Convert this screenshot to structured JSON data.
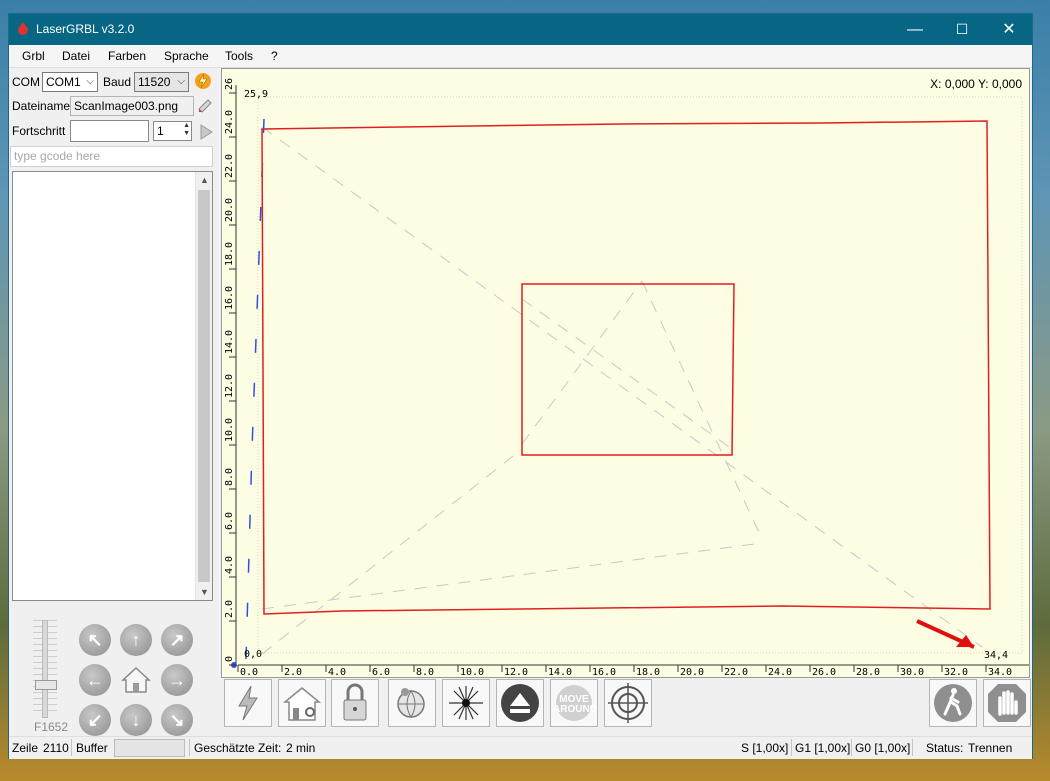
{
  "window": {
    "title": "LaserGRBL v3.2.0",
    "minimize": "—",
    "maximize": "☐",
    "close": "✕"
  },
  "menu": [
    "Grbl",
    "Datei",
    "Farben",
    "Sprache",
    "Tools",
    "?"
  ],
  "connection": {
    "com_label": "COM",
    "com_value": "COM1",
    "baud_label": "Baud",
    "baud_value": "11520"
  },
  "file": {
    "label": "Dateiname",
    "value": "ScanImage003.png"
  },
  "progress": {
    "label": "Fortschritt",
    "passes": "1"
  },
  "gcode": {
    "placeholder": "type gcode here"
  },
  "jog": {
    "speed_label": "F1652"
  },
  "canvas": {
    "coords": "X: 0,000 Y: 0,000",
    "corner_top_left": "25,9",
    "corner_origin": "0,0",
    "corner_bottom_right": "34,4",
    "x_ticks": [
      "0.0",
      "2.0",
      "4.0",
      "6.0",
      "8.0",
      "10.0",
      "12.0",
      "14.0",
      "16.0",
      "18.0",
      "20.0",
      "22.0",
      "24.0",
      "26.0",
      "28.0",
      "30.0",
      "32.0",
      "34.0"
    ],
    "y_ticks": [
      "0",
      "2.0",
      "4.0",
      "6.0",
      "8.0",
      "10.0",
      "12.0",
      "14.0",
      "16.0",
      "18.0",
      "20.0",
      "22.0",
      "24.0",
      "26"
    ]
  },
  "toolbar": [
    "connect",
    "home",
    "unlock",
    "world-position",
    "laser-focus",
    "eject",
    "move-around",
    "center"
  ],
  "toolbar_move_label": "MOVE AROUND",
  "status": {
    "line_label": "Zeile",
    "line_value": "2110",
    "buffer_label": "Buffer",
    "time_label": "Geschätzte Zeit:",
    "time_value": "2 min",
    "s_override": "S [1,00x]",
    "g1_override": "G1 [1,00x]",
    "g0_override": "G0 [1,00x]",
    "status_label": "Status:",
    "status_value": "Trennen"
  },
  "colors": {
    "titlebar": "#076684",
    "canvas_bg": "#fdfde3",
    "path_red": "#e02020",
    "travel_blue": "#3050e0"
  }
}
